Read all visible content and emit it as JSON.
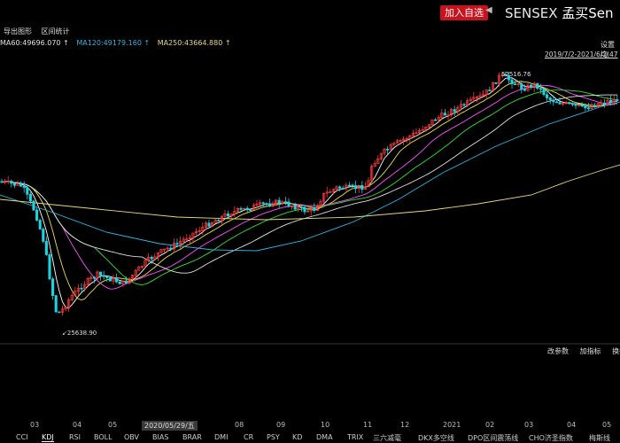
{
  "header": {
    "add_watchlist": "加入自选",
    "symbol": "SENSEX",
    "name": "孟买Sen"
  },
  "toolbar": {
    "export_image": "导出图形",
    "range_stats": "区间统计",
    "settings": "设置均"
  },
  "ma": [
    {
      "label": "MA60:49696.070 ↑",
      "color": "#e0e0e0"
    },
    {
      "label": "MA120:49179.160 ↑",
      "color": "#29b6e6"
    },
    {
      "label": "MA250:43664.880 ↑",
      "color": "#e8d77c"
    }
  ],
  "date_range": "2019/7/2-2021/6/2(47",
  "price_high": "52516.76",
  "price_low": "25638.90",
  "sub_toolbar": {
    "edit_params": "改参数",
    "add_indicator": "加指标",
    "switch": "换指"
  },
  "x_axis": {
    "labels": [
      "03",
      "04",
      "05",
      "2020/05/29/五",
      "08",
      "09",
      "10",
      "11",
      "12",
      "2021",
      "02",
      "03",
      "04",
      "05"
    ]
  },
  "indicator_tabs": [
    "CCI",
    "KDJ",
    "RSI",
    "BOLL",
    "OBV",
    "BIAS",
    "BRAR",
    "DMI",
    "CR",
    "PSY",
    "KD",
    "DMA",
    "TRIX",
    "三六减毫",
    "DKX多空线",
    "DPO区间震荡线",
    "CHO济圣指数",
    "梅斯线"
  ],
  "selected_tab": "KDJ",
  "colors": {
    "up": "#ff3b3b",
    "down": "#1fd3e0",
    "ma5": "#ffffff",
    "ma10": "#f0e040",
    "ma20": "#ff50ff",
    "ma30": "#30e030",
    "ma60": "#e0e0e0",
    "ma120": "#29b6e6",
    "ma250": "#e8d77c"
  }
}
